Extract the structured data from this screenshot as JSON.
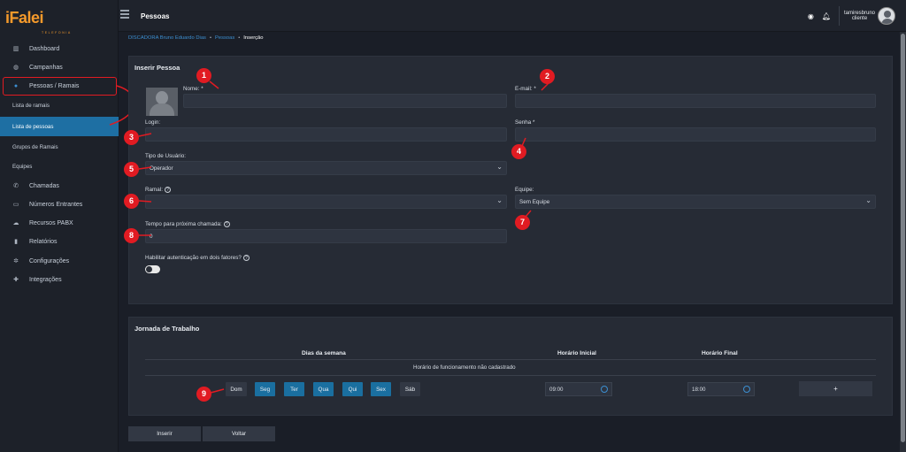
{
  "brand": {
    "logo_text": "iFalei",
    "logo_sub": "TELEFONIA"
  },
  "sidebar": {
    "items": [
      {
        "label": "Dashboard",
        "icon": "chart-icon"
      },
      {
        "label": "Campanhas",
        "icon": "globe-icon"
      },
      {
        "label": "Pessoas / Ramais",
        "icon": "user-icon"
      },
      {
        "label": "Chamadas",
        "icon": "phone-icon"
      },
      {
        "label": "Números Entrantes",
        "icon": "id-card-icon"
      },
      {
        "label": "Recursos PABX",
        "icon": "cloud-icon"
      },
      {
        "label": "Relatórios",
        "icon": "clipboard-icon"
      },
      {
        "label": "Configurações",
        "icon": "gear-icon"
      },
      {
        "label": "Integrações",
        "icon": "puzzle-icon"
      }
    ],
    "subitems": [
      {
        "label": "Lista de ramais"
      },
      {
        "label": "Lista de pessoas"
      },
      {
        "label": "Grupos de Ramais"
      },
      {
        "label": "Equipes"
      }
    ]
  },
  "header": {
    "title": "Pessoas",
    "username": "tamiresbruno",
    "role": "cliente"
  },
  "breadcrumb": {
    "root": "DISCADORA Bruno Eduardo Dias",
    "section": "Pessoas",
    "current": "Inserção"
  },
  "form": {
    "title": "Inserir Pessoa",
    "nome_label": "Nome: *",
    "email_label": "E-mail: *",
    "login_label": "Login:",
    "senha_label": "Senha *",
    "tipo_label": "Tipo de Usuário:",
    "tipo_value": "Operador",
    "ramal_label": "Ramal:",
    "equipe_label": "Equipe:",
    "equipe_value": "Sem Equipe",
    "tempo_label": "Tempo para próxima chamada:",
    "tempo_value": "0",
    "twofa_label": "Habilitar autenticação em dois fatores?"
  },
  "jornada": {
    "title": "Jornada de Trabalho",
    "col_dias": "Dias da semana",
    "col_inicio": "Horário Inicial",
    "col_fim": "Horário Final",
    "empty_msg": "Horário de funcionamento não cadastrado",
    "days": [
      {
        "label": "Dom",
        "active": false
      },
      {
        "label": "Seg",
        "active": true
      },
      {
        "label": "Ter",
        "active": true
      },
      {
        "label": "Qua",
        "active": true
      },
      {
        "label": "Qui",
        "active": true
      },
      {
        "label": "Sex",
        "active": true
      },
      {
        "label": "Sáb",
        "active": false
      }
    ],
    "start_time": "09:00",
    "end_time": "18:00",
    "add_label": "+"
  },
  "actions": {
    "insert": "Inserir",
    "back": "Voltar"
  },
  "annotations": {
    "n1": "1",
    "n2": "2",
    "n3": "3",
    "n4": "4",
    "n5": "5",
    "n6": "6",
    "n7": "7",
    "n8": "8",
    "n9": "9"
  },
  "colors": {
    "accent": "#1a6fa0",
    "brand": "#f59a2b",
    "annotation": "#e11b22"
  }
}
